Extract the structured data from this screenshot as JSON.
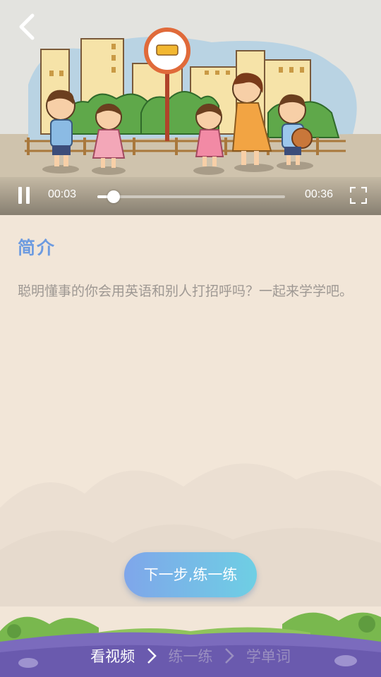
{
  "player": {
    "current_time": "00:03",
    "total_time": "00:36",
    "progress_fraction": 0.085
  },
  "intro": {
    "title": "简介",
    "description": "聪明懂事的你会用英语和别人打招呼吗？一起来学学吧。"
  },
  "actions": {
    "next_label": "下一步,练一练"
  },
  "steps": [
    {
      "label": "看视频",
      "active": true
    },
    {
      "label": "练一练",
      "active": false
    },
    {
      "label": "学单词",
      "active": false
    }
  ],
  "colors": {
    "accent_title": "#6d9be0",
    "button_gradient_start": "#7fa6ea",
    "button_gradient_end": "#6ecfe4",
    "page_bg": "#f2e6d8"
  }
}
